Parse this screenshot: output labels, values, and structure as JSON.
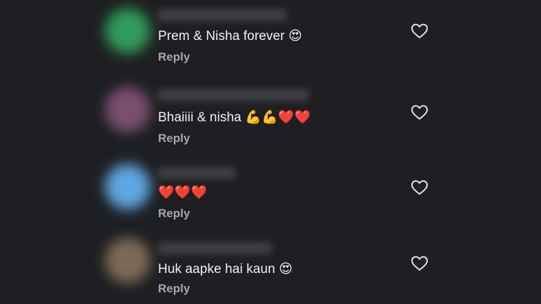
{
  "comments": [
    {
      "text": "Prem & Nisha forever 😍",
      "reply_label": "Reply",
      "avatar_color": "#2f9b5a"
    },
    {
      "text": "Bhaiiii & nisha 💪💪❤️❤️",
      "reply_label": "Reply",
      "avatar_color": "#7a4f6e"
    },
    {
      "text": "❤️❤️❤️",
      "reply_label": "Reply",
      "avatar_color": "#5fa6e0"
    },
    {
      "text": "Huk aapke hai kaun 😍",
      "reply_label": "Reply",
      "avatar_color": "#7d6a55"
    }
  ],
  "colors": {
    "background": "#1e1f22",
    "text": "#f2f2f2",
    "reply": "#a8a8ab",
    "like_icon": "#e6e6e6"
  },
  "icons": {
    "like": "heart-outline-icon"
  }
}
